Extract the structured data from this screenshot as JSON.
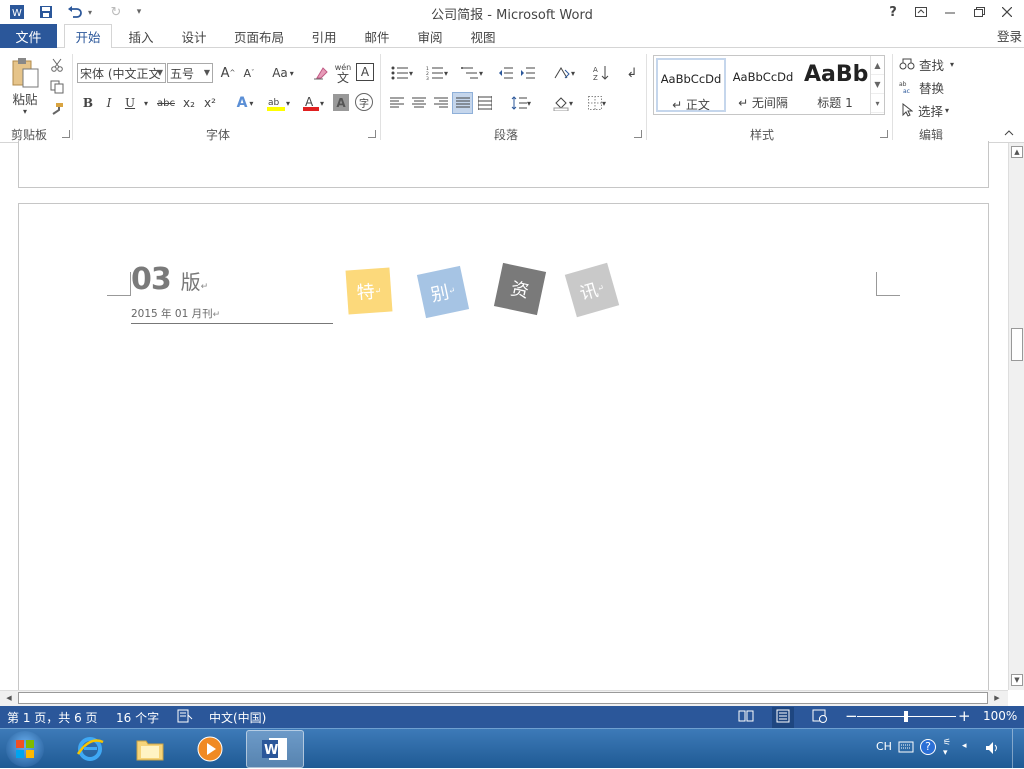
{
  "app": {
    "window_title": "公司简报 - Microsoft Word",
    "sign_in": "登录",
    "help": "?"
  },
  "tabs": [
    {
      "label": "文件"
    },
    {
      "label": "开始"
    },
    {
      "label": "插入"
    },
    {
      "label": "设计"
    },
    {
      "label": "页面布局"
    },
    {
      "label": "引用"
    },
    {
      "label": "邮件"
    },
    {
      "label": "审阅"
    },
    {
      "label": "视图"
    }
  ],
  "ribbon": {
    "clipboard": {
      "paste_label": "粘贴",
      "group_label": "剪贴板"
    },
    "font": {
      "font_name": "宋体 (中文正文",
      "font_size": "五号",
      "group_label": "字体",
      "change_case": "Aa",
      "phonetic_top": "wén",
      "phonetic_bottom": "文",
      "char_border": "A",
      "bold": "B",
      "italic": "I",
      "underline": "U",
      "strikethrough": "abc",
      "subscript": "x₂",
      "superscript": "x²",
      "enclose": "字"
    },
    "paragraph": {
      "group_label": "段落"
    },
    "styles": {
      "group_label": "样式",
      "items": [
        {
          "sample": "AaBbCcDd",
          "name": "↵ 正文"
        },
        {
          "sample": "AaBbCcDd",
          "name": "↵ 无间隔"
        },
        {
          "sample": "AaBb",
          "name": "标题 1"
        }
      ]
    },
    "editing": {
      "group_label": "编辑",
      "find": "查找",
      "replace": "替换",
      "select": "选择"
    }
  },
  "document": {
    "issue_number": "03",
    "issue_suffix": "版",
    "issue_date": "2015 年 01 月刊",
    "stickers": [
      {
        "text": "特",
        "color": "#fcd97b"
      },
      {
        "text": "别",
        "color": "#a6c4e4"
      },
      {
        "text": "资",
        "color": "#7a7a7a"
      },
      {
        "text": "讯",
        "color": "#c9c9c9"
      }
    ]
  },
  "status": {
    "page": "第 1 页，共 6 页",
    "words": "16 个字",
    "language": "中文(中国)",
    "zoom": "100%"
  },
  "taskbar": {
    "ime": "CH"
  },
  "colors": {
    "accent": "#2b579a"
  }
}
